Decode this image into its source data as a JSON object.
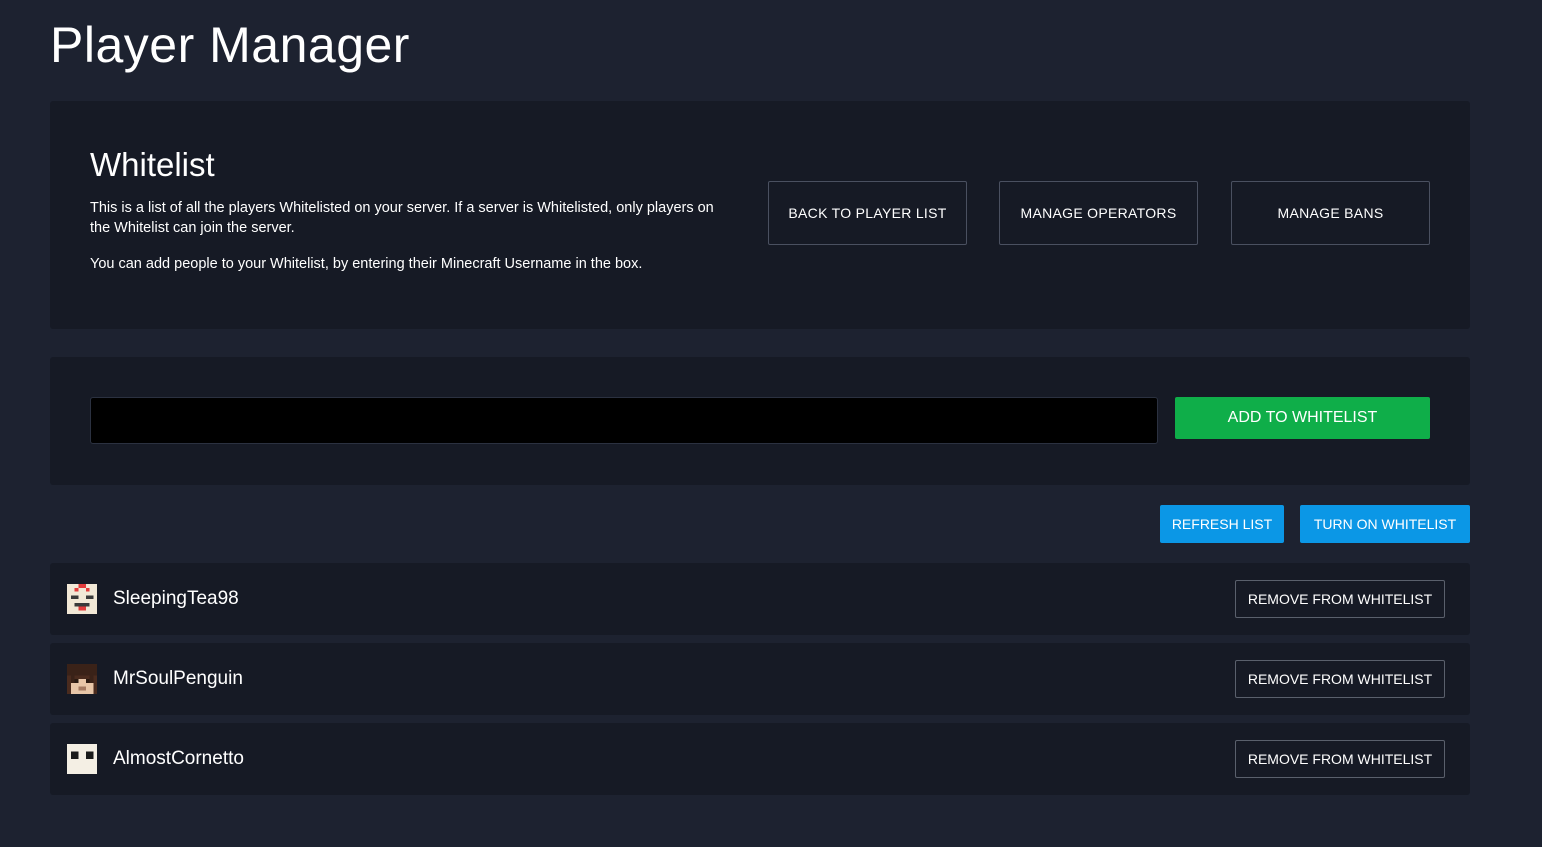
{
  "page": {
    "title": "Player Manager"
  },
  "whitelist_info": {
    "heading": "Whitelist",
    "description": "This is a list of all the players Whitelisted on your server. If a server is Whitelisted, only players on the Whitelist can join the server.",
    "instructions": "You can add people to your Whitelist, by entering their Minecraft Username in the box."
  },
  "nav_buttons": {
    "back": "BACK TO PLAYER LIST",
    "operators": "MANAGE OPERATORS",
    "bans": "MANAGE BANS"
  },
  "add_form": {
    "input_value": "",
    "input_placeholder": "",
    "add_label": "ADD TO WHITELIST"
  },
  "list_actions": {
    "refresh": "REFRESH LIST",
    "toggle": "TURN ON WHITELIST"
  },
  "players": [
    {
      "name": "SleepingTea98",
      "avatar_icon": "player-head-icon",
      "remove_label": "REMOVE FROM WHITELIST"
    },
    {
      "name": "MrSoulPenguin",
      "avatar_icon": "player-head-icon",
      "remove_label": "REMOVE FROM WHITELIST"
    },
    {
      "name": "AlmostCornetto",
      "avatar_icon": "player-head-icon",
      "remove_label": "REMOVE FROM WHITELIST"
    }
  ],
  "colors": {
    "background": "#1d2230",
    "panel": "#161a25",
    "add_button": "#0fae49",
    "action_button": "#0b97e6",
    "input_background": "#000000"
  }
}
